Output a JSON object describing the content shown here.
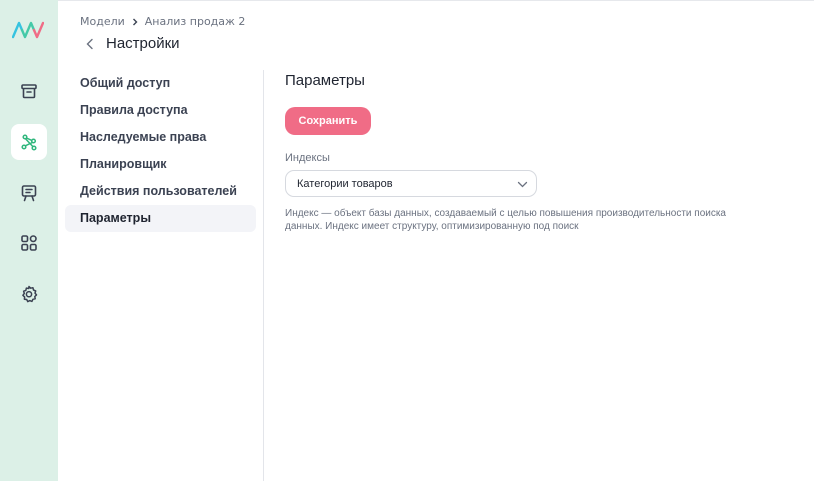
{
  "breadcrumb": {
    "parent": "Модели",
    "current": "Анализ продаж 2"
  },
  "header": {
    "title": "Настройки"
  },
  "nav": {
    "items": [
      {
        "label": "Общий доступ"
      },
      {
        "label": "Правила доступа"
      },
      {
        "label": "Наследуемые права"
      },
      {
        "label": "Планировщик"
      },
      {
        "label": "Действия пользователей"
      },
      {
        "label": "Параметры",
        "active": true
      }
    ]
  },
  "main": {
    "section_title": "Параметры",
    "save_label": "Сохранить",
    "indexes_label": "Индексы",
    "indexes_selected": "Категории товаров",
    "help_text": "Индекс — объект базы данных, создаваемый с целью повышения производительности поиска данных. Индекс имеет структуру, оптимизированную под поиск"
  },
  "rail": {
    "icons": [
      "archive-icon",
      "model-graph-icon",
      "presentation-icon",
      "apps-grid-icon",
      "gear-icon"
    ],
    "active_index": 1
  },
  "colors": {
    "accent": "#f06c86",
    "rail_bg": "#dcf0e7",
    "active_icon": "#2fb67c"
  }
}
